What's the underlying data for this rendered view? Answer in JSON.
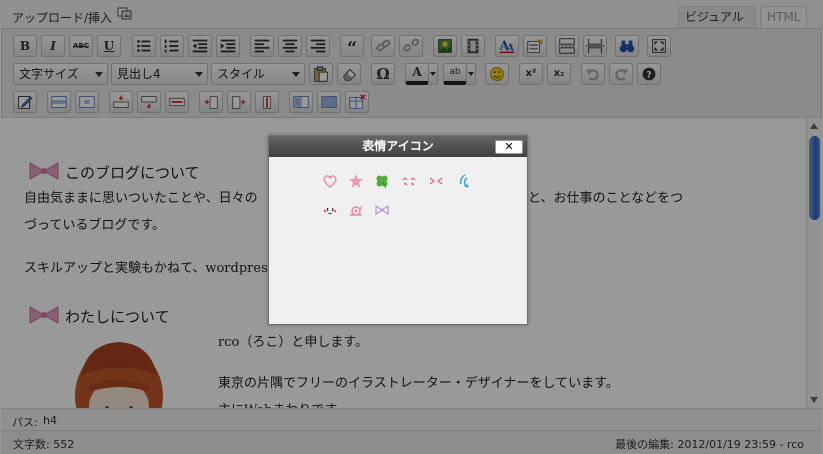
{
  "header": {
    "upload_label": "アップロード/挿入",
    "tabs": [
      {
        "label": "ビジュアル",
        "active": true
      },
      {
        "label": "HTML",
        "active": false
      }
    ]
  },
  "toolbar": {
    "row1": [
      "bold",
      "italic",
      "strikethrough",
      "underline",
      "bullet-list",
      "numbered-list",
      "outdent",
      "indent",
      "align-left",
      "align-center",
      "align-right",
      "blockquote",
      "insert-link",
      "remove-link",
      "insert-image",
      "insert-media",
      "spellcheck",
      "insert-template",
      "insert-more",
      "page-break",
      "search-replace",
      "fullscreen"
    ],
    "bold_label": "B",
    "italic_label": "I",
    "strike_label": "ABC",
    "underline_label": "U",
    "quote_label": "“",
    "omega_label": "Ω",
    "textcolor_label": "A",
    "highlight_label": "ab",
    "superscript_label": "x²",
    "subscript_label": "x₂",
    "help_label": "?",
    "font_size_select": "文字サイズ",
    "format_select": "見出し4",
    "style_select": "スタイル"
  },
  "content": {
    "heading1": "このブログについて",
    "para1_line1": "自由気ままに思いついたことや、日々の",
    "para1_line1_tail": "と、お仕事のことなどをつ",
    "para1_line2": "づっているブログです。",
    "para2": "スキルアップと実験もかねて、wordpres",
    "heading2": "わたしについて",
    "para3": "rco（ろこ）と申します。",
    "para4": "東京の片隅でフリーのイラストレーター・デザイナーをしています。",
    "para5": "主にWebまわりです。"
  },
  "path": {
    "label": "パス:",
    "value": "h4"
  },
  "status": {
    "word_count": "文字数: 552",
    "last_edit": "最後の編集: 2012/01/19 23:59 - rco"
  },
  "dialog": {
    "title": "表情アイコン",
    "close_label": "✕",
    "emoticons": [
      "heart-emoticon",
      "star-emoticon",
      "clover-emoticon",
      "blush-emoticon",
      "squint-emoticon",
      "sweat-emoticon",
      "smile-face-emoticon",
      "snail-emoticon",
      "ribbon-emoticon"
    ]
  },
  "colors": {
    "accent": "#2f63c4",
    "ribbon": "#e8a0c0",
    "overlay": "rgba(0,0,0,0.40)"
  }
}
